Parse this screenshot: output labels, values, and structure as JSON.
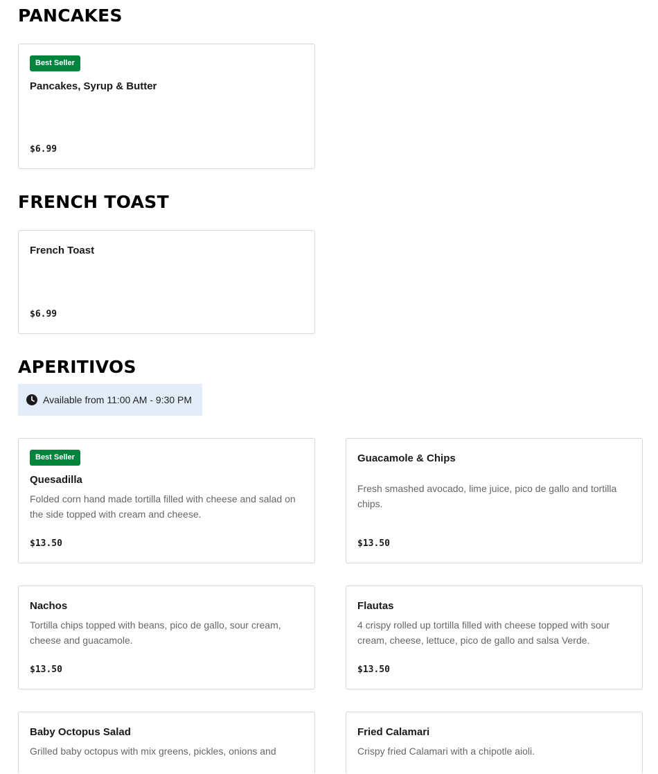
{
  "sections": [
    {
      "title": "PANCAKES",
      "items": [
        {
          "badge": "Best Seller",
          "name": "Pancakes, Syrup & Butter",
          "price": "$6.99"
        }
      ]
    },
    {
      "title": "FRENCH TOAST",
      "items": [
        {
          "name": "French Toast",
          "price": "$6.99"
        }
      ]
    },
    {
      "title": "APERITIVOS",
      "availability": {
        "icon": "clock-icon",
        "text": "Available from 11:00 AM - 9:30 PM"
      },
      "items": [
        {
          "badge": "Best Seller",
          "name": "Quesadilla",
          "description": "Folded corn hand made tortilla filled with cheese and salad on the side topped with cream and cheese.",
          "price": "$13.50"
        },
        {
          "name": "Guacamole & Chips",
          "description": "Fresh smashed avocado, lime juice, pico de gallo and tortilla chips.",
          "price": "$13.50"
        },
        {
          "name": "Nachos",
          "description": "Tortilla chips topped with beans, pico de gallo, sour cream, cheese and guacamole.",
          "price": "$13.50"
        },
        {
          "name": "Flautas",
          "description": "4 crispy rolled up tortilla filled with cheese topped with sour cream, cheese, lettuce, pico de gallo and salsa Verde.",
          "price": "$13.50"
        },
        {
          "name": "Baby Octopus Salad",
          "description": "Grilled baby octopus with mix greens, pickles, onions and",
          "price": ""
        },
        {
          "name": "Fried Calamari",
          "description": "Crispy fried Calamari with a chipotle aioli.",
          "price": ""
        }
      ]
    }
  ],
  "colors": {
    "badge": "#00843d",
    "availability_bg": "#e3edf9",
    "card_border": "#d6d6d6"
  }
}
